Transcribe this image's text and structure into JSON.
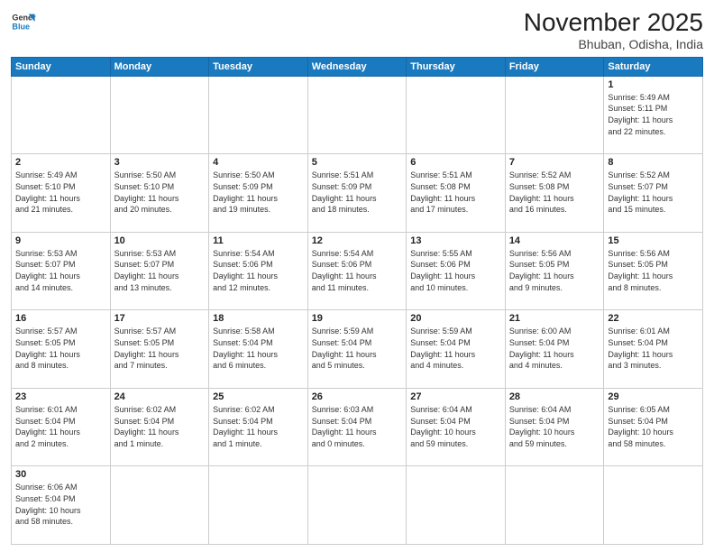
{
  "header": {
    "logo_general": "General",
    "logo_blue": "Blue",
    "month_title": "November 2025",
    "location": "Bhuban, Odisha, India"
  },
  "weekdays": [
    "Sunday",
    "Monday",
    "Tuesday",
    "Wednesday",
    "Thursday",
    "Friday",
    "Saturday"
  ],
  "weeks": [
    [
      {
        "day": "",
        "info": ""
      },
      {
        "day": "",
        "info": ""
      },
      {
        "day": "",
        "info": ""
      },
      {
        "day": "",
        "info": ""
      },
      {
        "day": "",
        "info": ""
      },
      {
        "day": "",
        "info": ""
      },
      {
        "day": "1",
        "info": "Sunrise: 5:49 AM\nSunset: 5:11 PM\nDaylight: 11 hours\nand 22 minutes."
      }
    ],
    [
      {
        "day": "2",
        "info": "Sunrise: 5:49 AM\nSunset: 5:10 PM\nDaylight: 11 hours\nand 21 minutes."
      },
      {
        "day": "3",
        "info": "Sunrise: 5:50 AM\nSunset: 5:10 PM\nDaylight: 11 hours\nand 20 minutes."
      },
      {
        "day": "4",
        "info": "Sunrise: 5:50 AM\nSunset: 5:09 PM\nDaylight: 11 hours\nand 19 minutes."
      },
      {
        "day": "5",
        "info": "Sunrise: 5:51 AM\nSunset: 5:09 PM\nDaylight: 11 hours\nand 18 minutes."
      },
      {
        "day": "6",
        "info": "Sunrise: 5:51 AM\nSunset: 5:08 PM\nDaylight: 11 hours\nand 17 minutes."
      },
      {
        "day": "7",
        "info": "Sunrise: 5:52 AM\nSunset: 5:08 PM\nDaylight: 11 hours\nand 16 minutes."
      },
      {
        "day": "8",
        "info": "Sunrise: 5:52 AM\nSunset: 5:07 PM\nDaylight: 11 hours\nand 15 minutes."
      }
    ],
    [
      {
        "day": "9",
        "info": "Sunrise: 5:53 AM\nSunset: 5:07 PM\nDaylight: 11 hours\nand 14 minutes."
      },
      {
        "day": "10",
        "info": "Sunrise: 5:53 AM\nSunset: 5:07 PM\nDaylight: 11 hours\nand 13 minutes."
      },
      {
        "day": "11",
        "info": "Sunrise: 5:54 AM\nSunset: 5:06 PM\nDaylight: 11 hours\nand 12 minutes."
      },
      {
        "day": "12",
        "info": "Sunrise: 5:54 AM\nSunset: 5:06 PM\nDaylight: 11 hours\nand 11 minutes."
      },
      {
        "day": "13",
        "info": "Sunrise: 5:55 AM\nSunset: 5:06 PM\nDaylight: 11 hours\nand 10 minutes."
      },
      {
        "day": "14",
        "info": "Sunrise: 5:56 AM\nSunset: 5:05 PM\nDaylight: 11 hours\nand 9 minutes."
      },
      {
        "day": "15",
        "info": "Sunrise: 5:56 AM\nSunset: 5:05 PM\nDaylight: 11 hours\nand 8 minutes."
      }
    ],
    [
      {
        "day": "16",
        "info": "Sunrise: 5:57 AM\nSunset: 5:05 PM\nDaylight: 11 hours\nand 8 minutes."
      },
      {
        "day": "17",
        "info": "Sunrise: 5:57 AM\nSunset: 5:05 PM\nDaylight: 11 hours\nand 7 minutes."
      },
      {
        "day": "18",
        "info": "Sunrise: 5:58 AM\nSunset: 5:04 PM\nDaylight: 11 hours\nand 6 minutes."
      },
      {
        "day": "19",
        "info": "Sunrise: 5:59 AM\nSunset: 5:04 PM\nDaylight: 11 hours\nand 5 minutes."
      },
      {
        "day": "20",
        "info": "Sunrise: 5:59 AM\nSunset: 5:04 PM\nDaylight: 11 hours\nand 4 minutes."
      },
      {
        "day": "21",
        "info": "Sunrise: 6:00 AM\nSunset: 5:04 PM\nDaylight: 11 hours\nand 4 minutes."
      },
      {
        "day": "22",
        "info": "Sunrise: 6:01 AM\nSunset: 5:04 PM\nDaylight: 11 hours\nand 3 minutes."
      }
    ],
    [
      {
        "day": "23",
        "info": "Sunrise: 6:01 AM\nSunset: 5:04 PM\nDaylight: 11 hours\nand 2 minutes."
      },
      {
        "day": "24",
        "info": "Sunrise: 6:02 AM\nSunset: 5:04 PM\nDaylight: 11 hours\nand 1 minute."
      },
      {
        "day": "25",
        "info": "Sunrise: 6:02 AM\nSunset: 5:04 PM\nDaylight: 11 hours\nand 1 minute."
      },
      {
        "day": "26",
        "info": "Sunrise: 6:03 AM\nSunset: 5:04 PM\nDaylight: 11 hours\nand 0 minutes."
      },
      {
        "day": "27",
        "info": "Sunrise: 6:04 AM\nSunset: 5:04 PM\nDaylight: 10 hours\nand 59 minutes."
      },
      {
        "day": "28",
        "info": "Sunrise: 6:04 AM\nSunset: 5:04 PM\nDaylight: 10 hours\nand 59 minutes."
      },
      {
        "day": "29",
        "info": "Sunrise: 6:05 AM\nSunset: 5:04 PM\nDaylight: 10 hours\nand 58 minutes."
      }
    ],
    [
      {
        "day": "30",
        "info": "Sunrise: 6:06 AM\nSunset: 5:04 PM\nDaylight: 10 hours\nand 58 minutes."
      },
      {
        "day": "",
        "info": ""
      },
      {
        "day": "",
        "info": ""
      },
      {
        "day": "",
        "info": ""
      },
      {
        "day": "",
        "info": ""
      },
      {
        "day": "",
        "info": ""
      },
      {
        "day": "",
        "info": ""
      }
    ]
  ]
}
